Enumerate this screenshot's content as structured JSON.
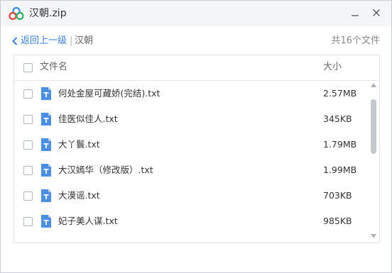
{
  "window": {
    "title": "汉朝.zip",
    "icons": {
      "logo": "baidu-netdisk-logo-icon",
      "minimize": "minimize-icon",
      "close": "close-icon"
    }
  },
  "nav": {
    "back_label": "返回上一级",
    "separator": "|",
    "current_folder": "汉朝",
    "file_count": "共16个文件"
  },
  "list": {
    "header": {
      "name_label": "文件名",
      "size_label": "大小"
    },
    "files": [
      {
        "name": "何处金屋可藏娇(完结).txt",
        "size": "2.57MB"
      },
      {
        "name": "佳医似佳人.txt",
        "size": "345KB"
      },
      {
        "name": "大丫鬟.txt",
        "size": "1.79MB"
      },
      {
        "name": "大汉嫣华（修改版）.txt",
        "size": "1.99MB"
      },
      {
        "name": "大漠谣.txt",
        "size": "703KB"
      },
      {
        "name": "妃子美人谋.txt",
        "size": "985KB"
      }
    ],
    "file_icon": "txt-file-icon",
    "accent_color": "#4a8ee6"
  }
}
